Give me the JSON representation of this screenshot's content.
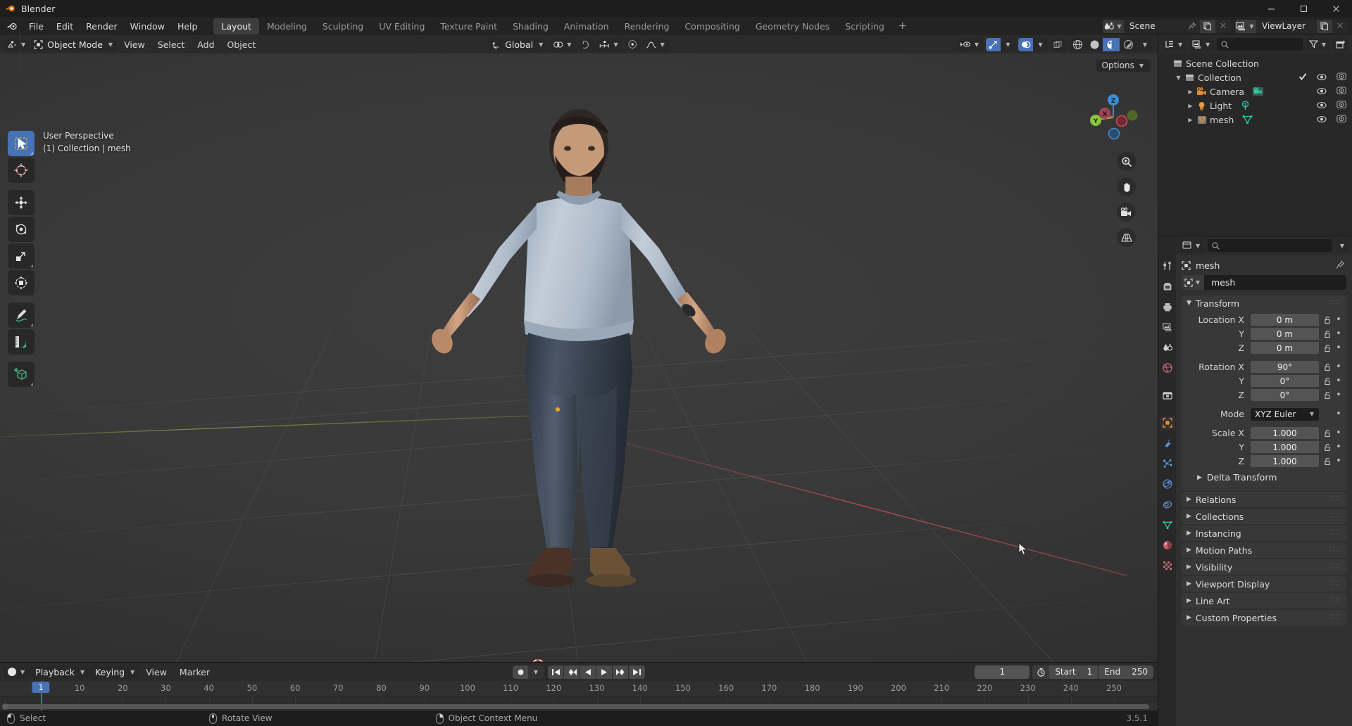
{
  "window": {
    "title": "Blender",
    "minimize": "–",
    "maximize": "▢",
    "close": "✕"
  },
  "topbar": {
    "menus": [
      "File",
      "Edit",
      "Render",
      "Window",
      "Help"
    ],
    "workspaces": [
      {
        "label": "Layout",
        "active": true
      },
      {
        "label": "Modeling",
        "active": false
      },
      {
        "label": "Sculpting",
        "active": false
      },
      {
        "label": "UV Editing",
        "active": false
      },
      {
        "label": "Texture Paint",
        "active": false
      },
      {
        "label": "Shading",
        "active": false
      },
      {
        "label": "Animation",
        "active": false
      },
      {
        "label": "Rendering",
        "active": false
      },
      {
        "label": "Compositing",
        "active": false
      },
      {
        "label": "Geometry Nodes",
        "active": false
      },
      {
        "label": "Scripting",
        "active": false
      }
    ],
    "add_workspace": "+",
    "scene_name": "Scene",
    "view_layer_name": "ViewLayer"
  },
  "viewport_header": {
    "mode": "Object Mode",
    "menus": [
      "View",
      "Select",
      "Add",
      "Object"
    ],
    "transform_orientation": "Global",
    "options_label": "Options"
  },
  "viewport": {
    "perspective_label": "User Perspective",
    "collection_label": "(1) Collection | mesh",
    "gizmo_axes": {
      "x": "X",
      "y": "Y",
      "z": "Z"
    },
    "axis_colors": {
      "x": "#cc4a5a",
      "y": "#8bc63f",
      "z": "#3b8fd4"
    },
    "tools": [
      {
        "name": "tweak-select-box",
        "active": true
      },
      {
        "name": "cursor",
        "active": false
      },
      {
        "name": "move",
        "active": false
      },
      {
        "name": "rotate",
        "active": false
      },
      {
        "name": "scale",
        "active": false
      },
      {
        "name": "transform",
        "active": false
      },
      {
        "name": "annotate",
        "active": false
      },
      {
        "name": "measure",
        "active": false
      },
      {
        "name": "add-cube",
        "active": false
      }
    ]
  },
  "outliner": {
    "search_placeholder": "",
    "rows": [
      {
        "label": "Scene Collection",
        "depth": 0,
        "icon": "collection",
        "disclosure": "",
        "has_checkbox": false,
        "has_eye": false,
        "has_camera": false
      },
      {
        "label": "Collection",
        "depth": 1,
        "icon": "collection",
        "disclosure": "▼",
        "has_checkbox": true,
        "has_eye": true,
        "has_camera": true
      },
      {
        "label": "Camera",
        "depth": 2,
        "icon": "camera",
        "disclosure": "▶",
        "has_checkbox": false,
        "has_eye": true,
        "has_camera": true,
        "data_icon": "camera-data"
      },
      {
        "label": "Light",
        "depth": 2,
        "icon": "light",
        "disclosure": "▶",
        "has_checkbox": false,
        "has_eye": true,
        "has_camera": true,
        "data_icon": "light-data"
      },
      {
        "label": "mesh",
        "depth": 2,
        "icon": "mesh-object",
        "disclosure": "▶",
        "has_checkbox": false,
        "has_eye": true,
        "has_camera": true,
        "data_icon": "mesh-data"
      }
    ]
  },
  "properties": {
    "breadcrumb_object": "mesh",
    "object_name": "mesh",
    "transform": {
      "title": "Transform",
      "location_label_x": "Location X",
      "label_y": "Y",
      "label_z": "Z",
      "location_x": "0 m",
      "location_y": "0 m",
      "location_z": "0 m",
      "rotation_label_x": "Rotation X",
      "rotation_x": "90°",
      "rotation_y": "0°",
      "rotation_z": "0°",
      "mode_label": "Mode",
      "mode_value": "XYZ Euler",
      "scale_label_x": "Scale X",
      "scale_x": "1.000",
      "scale_y": "1.000",
      "scale_z": "1.000",
      "delta_transform": "Delta Transform"
    },
    "panels": [
      "Relations",
      "Collections",
      "Instancing",
      "Motion Paths",
      "Visibility",
      "Viewport Display",
      "Line Art",
      "Custom Properties"
    ],
    "tabs": [
      {
        "name": "tool",
        "active": false
      },
      {
        "name": "render",
        "active": false
      },
      {
        "name": "output",
        "active": false
      },
      {
        "name": "view-layer",
        "active": false
      },
      {
        "name": "scene",
        "active": false
      },
      {
        "name": "world",
        "active": false
      },
      {
        "name": "collection",
        "active": false
      },
      {
        "name": "object",
        "active": true
      },
      {
        "name": "modifiers",
        "active": false
      },
      {
        "name": "particles",
        "active": false
      },
      {
        "name": "physics",
        "active": false
      },
      {
        "name": "constraints",
        "active": false
      },
      {
        "name": "object-data",
        "active": false
      },
      {
        "name": "material",
        "active": false
      },
      {
        "name": "texture",
        "active": false
      }
    ]
  },
  "timeline": {
    "editor_menus": [
      "Playback",
      "Keying",
      "View",
      "Marker"
    ],
    "current_frame": "1",
    "start_label": "Start",
    "start_value": "1",
    "end_label": "End",
    "end_value": "250",
    "ticks": [
      1,
      10,
      20,
      30,
      40,
      50,
      60,
      70,
      80,
      90,
      100,
      110,
      120,
      130,
      140,
      150,
      160,
      170,
      180,
      190,
      200,
      210,
      220,
      230,
      240,
      250
    ],
    "playhead_frame": "1"
  },
  "statusbar": {
    "items": [
      {
        "icon": "mouse-left",
        "label": "Select"
      },
      {
        "icon": "mouse-middle",
        "label": "Rotate View"
      },
      {
        "icon": "mouse-right",
        "label": "Object Context Menu"
      }
    ],
    "version": "3.5.1"
  }
}
